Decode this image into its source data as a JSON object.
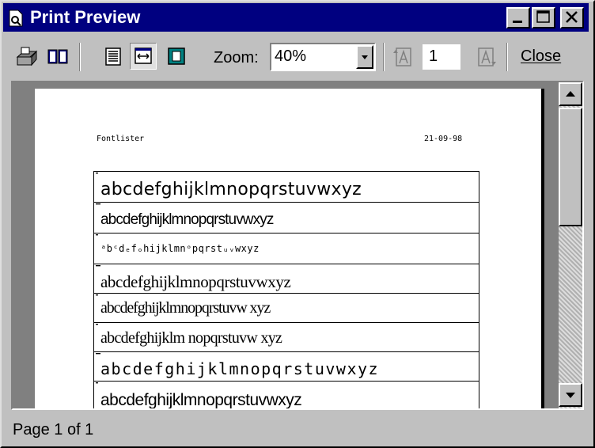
{
  "window": {
    "title": "Print Preview"
  },
  "toolbar": {
    "zoom_label": "Zoom:",
    "zoom_value": "40%",
    "page_number": "1",
    "close_label": "Close"
  },
  "page": {
    "header_left": "Fontlister",
    "header_right": "21-09-98",
    "samples": [
      "abcdefghijklmnopqrstuvwxyz",
      "abcdefghijklmnopqrstuvwxyz",
      "ᵃbᶜdₑfₒhijklmnᵒpqrstᵤᵥwxyz",
      "abcdefghijklmnopqrstuvwxyz",
      "abcdefghijklmnopqrstuvw xyz",
      "abcdefghijklm nopqrstuvw xyz",
      "abcdefghijklmnopqrstuvwxyz",
      "abcdefghijklmnopqrstuvwxyz"
    ]
  },
  "status": {
    "text": "Page 1 of 1"
  }
}
